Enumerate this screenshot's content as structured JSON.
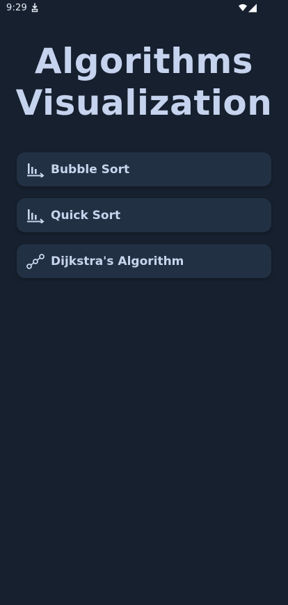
{
  "status_bar": {
    "time": "9:29",
    "icons": [
      "download-icon",
      "wifi-icon",
      "signal-icon"
    ]
  },
  "header": {
    "title_line1": "Algorithms",
    "title_line2": "Visualization"
  },
  "menu": {
    "items": [
      {
        "label": "Bubble Sort",
        "icon": "bar-chart-sort-icon"
      },
      {
        "label": "Quick Sort",
        "icon": "bar-chart-sort-icon"
      },
      {
        "label": "Dijkstra's Algorithm",
        "icon": "graph-nodes-icon"
      }
    ]
  },
  "colors": {
    "background": "#16202e",
    "card": "#223044",
    "text": "#c6d3ee"
  }
}
